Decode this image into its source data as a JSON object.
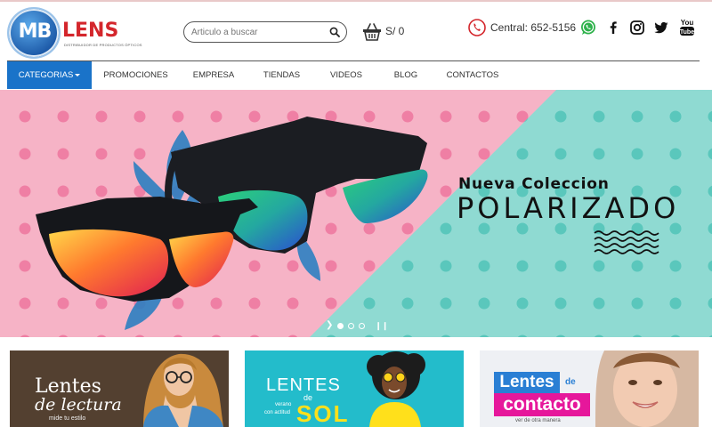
{
  "brand": {
    "logo_mb": "MB",
    "logo_lens": "LENS",
    "tagline": "DISTRIBUIDOR DE PRODUCTOS ÓPTICOS"
  },
  "search": {
    "placeholder": "Articulo a buscar",
    "icon": "search-icon"
  },
  "cart": {
    "icon": "basket-icon",
    "total": "S/ 0"
  },
  "contact": {
    "icon": "phone-icon",
    "central": "Central: 652-5156"
  },
  "social": [
    "whatsapp-icon",
    "facebook-icon",
    "instagram-icon",
    "twitter-icon",
    "youtube-icon"
  ],
  "nav": {
    "items": [
      "CATEGORIAS",
      "PROMOCIONES",
      "EMPRESA",
      "TIENDAS",
      "VIDEOS",
      "BLOG",
      "CONTACTOS"
    ],
    "active": 0
  },
  "banner": {
    "subtitle": "Nueva Coleccion",
    "title": "POLARIZADO",
    "slides": 3,
    "current_slide": 1
  },
  "cards": [
    {
      "title": "Lentes",
      "script": "de lectura",
      "caption": "mide tu estilo"
    },
    {
      "title": "LENTES",
      "connector": "de",
      "script": "SOL",
      "caption_1": "verano",
      "caption_2": "con actitud"
    },
    {
      "title": "Lentes",
      "connector": "de",
      "highlight": "contacto",
      "caption": "ver de otra manera"
    }
  ],
  "colors": {
    "accent_blue": "#1a73c9",
    "brand_red": "#d4262c",
    "banner_pink": "#f6b3c6",
    "banner_teal": "#8fdad2"
  }
}
